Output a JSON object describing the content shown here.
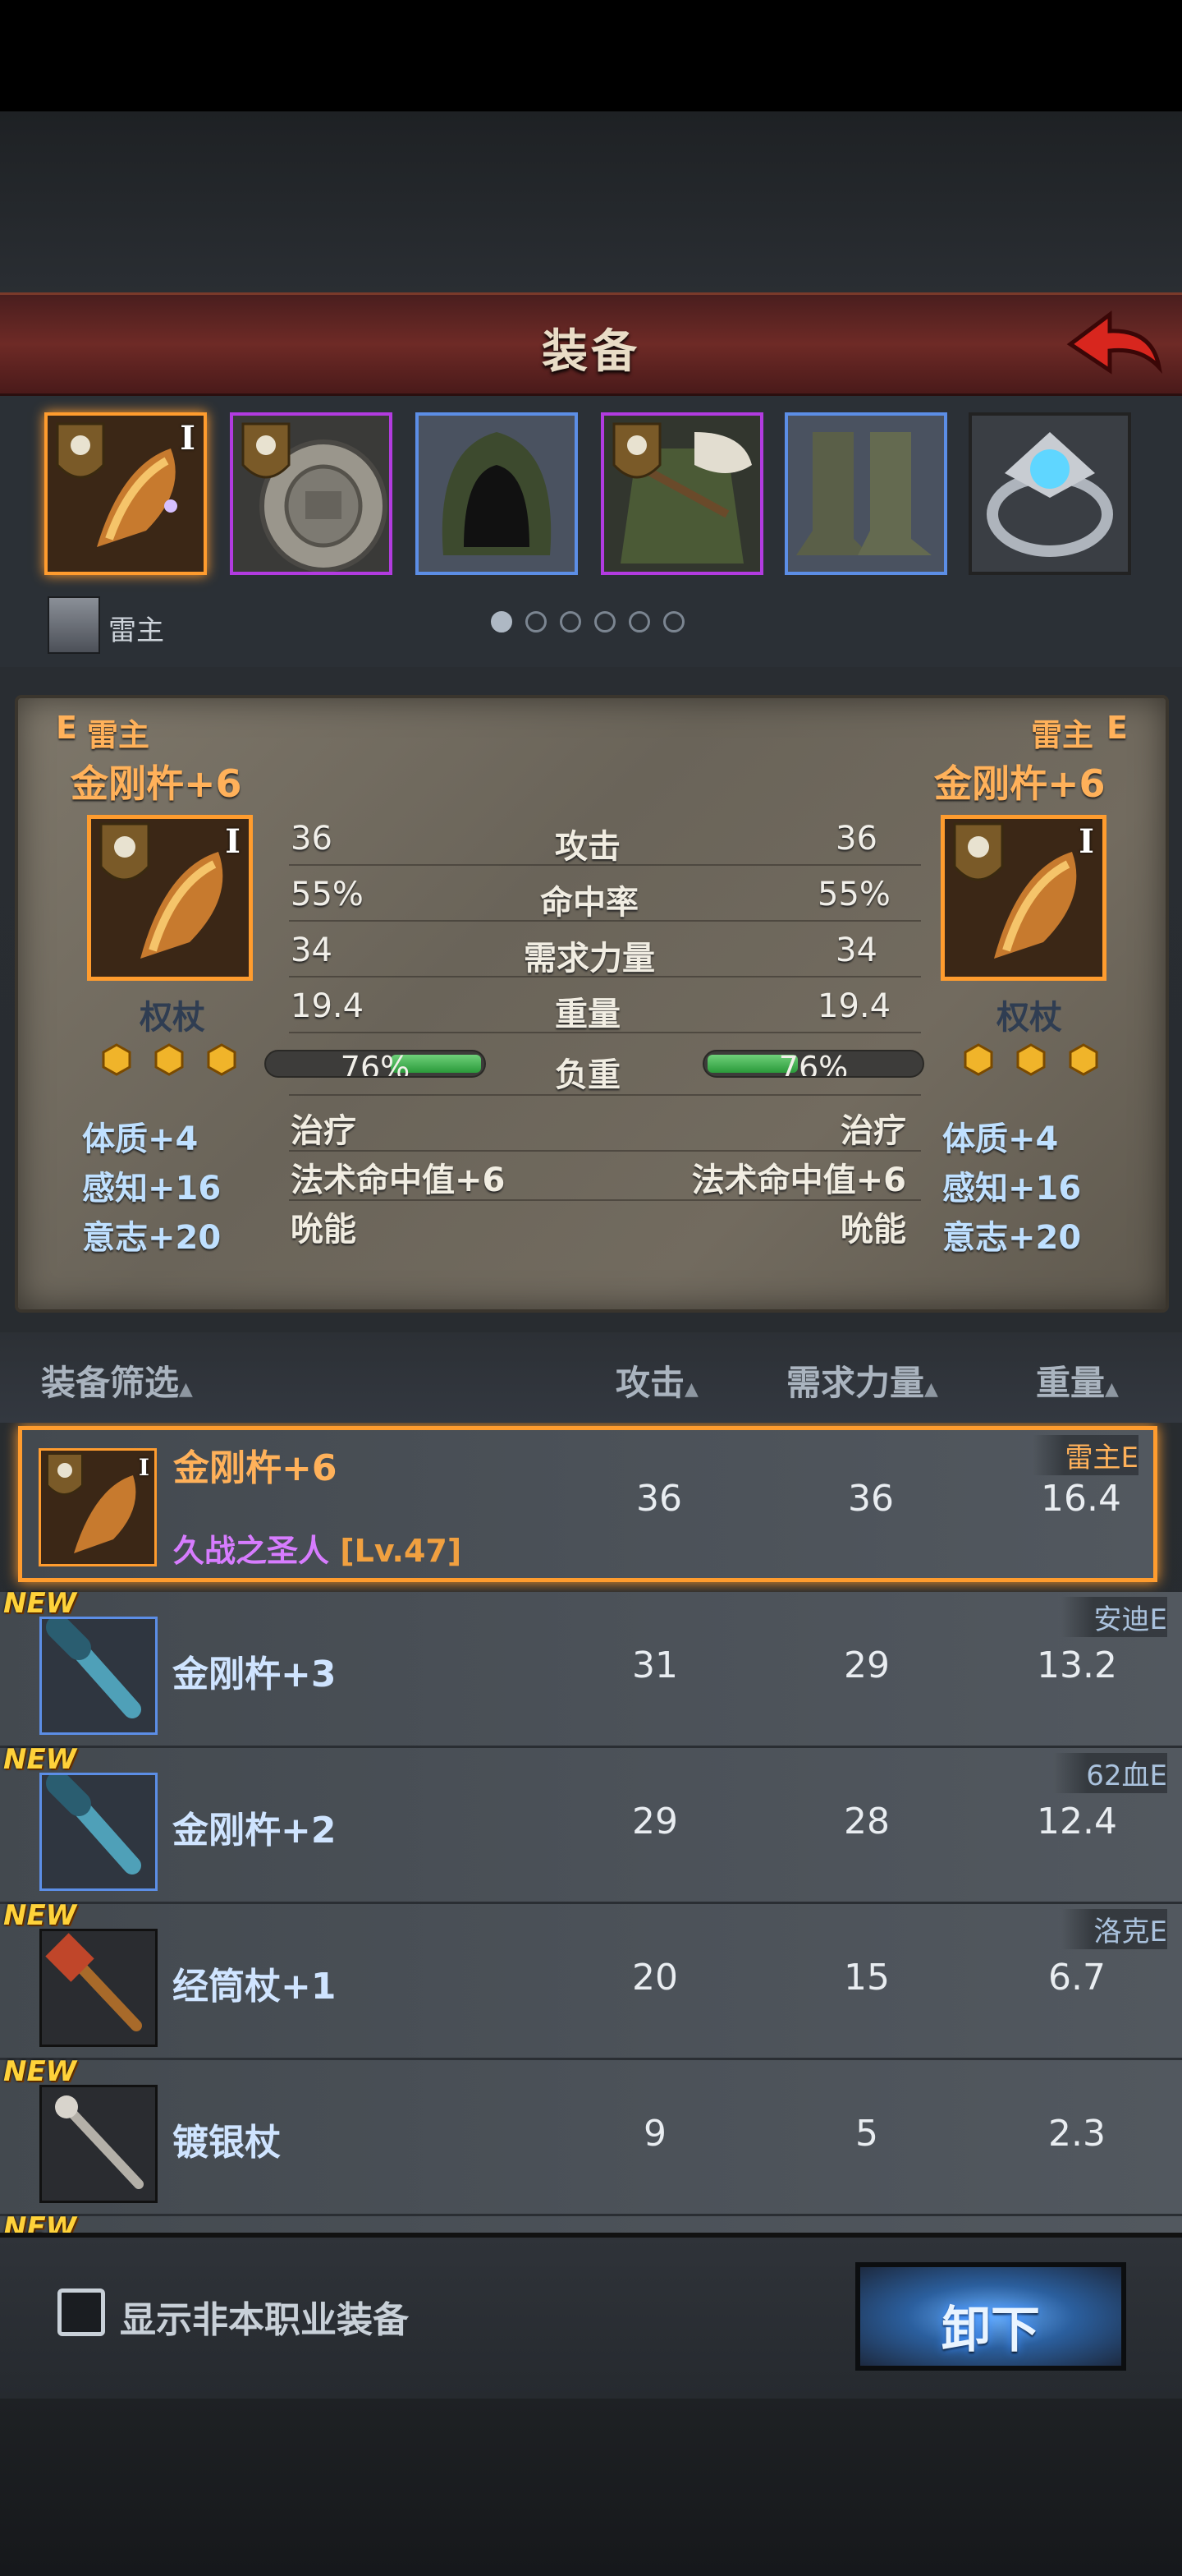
{
  "header": {
    "title": "装备"
  },
  "slots": [
    {
      "icon": "scepter-icon",
      "roman": "I",
      "border": "orange"
    },
    {
      "icon": "shield-icon",
      "roman": "",
      "border": "purple"
    },
    {
      "icon": "hood-icon",
      "roman": "",
      "border": "blue"
    },
    {
      "icon": "armor-icon",
      "roman": "",
      "border": "purple"
    },
    {
      "icon": "boots-icon",
      "roman": "",
      "border": "blue"
    },
    {
      "icon": "ring-icon",
      "roman": "",
      "border": "dark"
    }
  ],
  "owner": {
    "name": "雷主"
  },
  "pager": {
    "count": 6,
    "active": 0
  },
  "compare": {
    "left": {
      "grade": "E",
      "owner": "雷主",
      "name": "金刚杵+6",
      "roman": "I",
      "type": "权杖",
      "stats": {
        "attack": "36",
        "hit": "55%",
        "strength": "34",
        "weight": "19.4"
      },
      "load": {
        "label": "76%",
        "percent": 76
      },
      "attrs": [
        "体质+4",
        "感知+16",
        "意志+20"
      ],
      "effects": [
        "治疗",
        "法术命中值+6",
        "吮能"
      ]
    },
    "right": {
      "grade": "E",
      "owner": "雷主",
      "name": "金刚杵+6",
      "roman": "I",
      "type": "权杖",
      "stats": {
        "attack": "36",
        "hit": "55%",
        "strength": "34",
        "weight": "19.4"
      },
      "load": {
        "label": "76%",
        "percent": 76
      },
      "attrs": [
        "体质+4",
        "感知+16",
        "意志+20"
      ],
      "effects": [
        "治疗",
        "法术命中值+6",
        "吮能"
      ]
    },
    "labels": {
      "attack": "攻击",
      "hit": "命中率",
      "strength": "需求力量",
      "weight": "重量",
      "load": "负重"
    }
  },
  "list_header": {
    "filter": "装备筛选",
    "attack": "攻击",
    "strength": "需求力量",
    "weight": "重量"
  },
  "items": [
    {
      "name": "金刚杵+6",
      "sub": "久战之圣人",
      "level": "[Lv.47]",
      "attack": "36",
      "strength": "36",
      "weight": "16.4",
      "owner": "雷主E",
      "new": "",
      "selected": true
    },
    {
      "name": "金刚杵+3",
      "attack": "31",
      "strength": "29",
      "weight": "13.2",
      "owner": "安迪E",
      "new": "NEW"
    },
    {
      "name": "金刚杵+2",
      "attack": "29",
      "strength": "28",
      "weight": "12.4",
      "owner": "62血E",
      "new": "NEW"
    },
    {
      "name": "经筒杖+1",
      "attack": "20",
      "strength": "15",
      "weight": "6.7",
      "owner": "洛克E",
      "new": "NEW"
    },
    {
      "name": "镀银杖",
      "attack": "9",
      "strength": "5",
      "weight": "2.3",
      "owner": "",
      "new": "NEW"
    },
    {
      "name": "",
      "attack": "",
      "strength": "",
      "weight": "",
      "owner": "",
      "new": "NEW"
    }
  ],
  "footer": {
    "checkbox_label": "显示非本职业装备",
    "unequip": "卸下"
  },
  "colors": {
    "accent": "#ff9c2e",
    "purple": "#b23be0",
    "blue": "#5c8ee6",
    "green": "#2a9a3a"
  }
}
